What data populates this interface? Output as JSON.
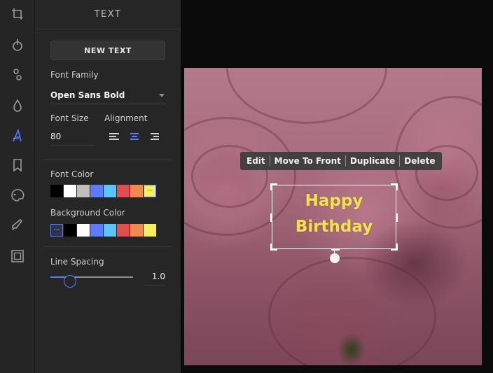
{
  "toolrail": {
    "tools": [
      {
        "name": "crop-icon"
      },
      {
        "name": "filter-icon"
      },
      {
        "name": "adjust-icon"
      },
      {
        "name": "drop-icon"
      },
      {
        "name": "text-icon",
        "active": true
      },
      {
        "name": "sticker-icon"
      },
      {
        "name": "paint-icon"
      },
      {
        "name": "brush-icon"
      },
      {
        "name": "frame-icon"
      }
    ],
    "active_color": "#5a7dff",
    "icon_color": "#9a9a9a"
  },
  "panel": {
    "title": "TEXT",
    "new_text_label": "NEW TEXT",
    "font_family_label": "Font Family",
    "font_family_value": "Open Sans Bold",
    "font_size_label": "Font Size",
    "font_size_value": "80",
    "alignment_label": "Alignment",
    "alignment_selected": "center",
    "font_color_label": "Font Color",
    "font_colors": [
      "#000000",
      "#ffffff",
      "#bfbfbf",
      "#5d7bff",
      "#5cc5f7",
      "#e24e4e",
      "#f1894f",
      "#f6ee5c"
    ],
    "font_color_selected_index": 7,
    "background_color_label": "Background Color",
    "background_colors": [
      "transparent",
      "#000000",
      "#ffffff",
      "#5d7bff",
      "#5cc5f7",
      "#e24e4e",
      "#f1894f",
      "#f6ee5c"
    ],
    "background_color_selected_index": 0,
    "selected_marker": "···",
    "line_spacing_label": "Line Spacing",
    "line_spacing_value": "1.0",
    "line_spacing_fraction": 0.24
  },
  "canvas": {
    "popup_actions": [
      "Edit",
      "Move To Front",
      "Duplicate",
      "Delete"
    ],
    "text_line1": "Happy",
    "text_line2": "Birthday",
    "text_color": "#f4e24a"
  }
}
